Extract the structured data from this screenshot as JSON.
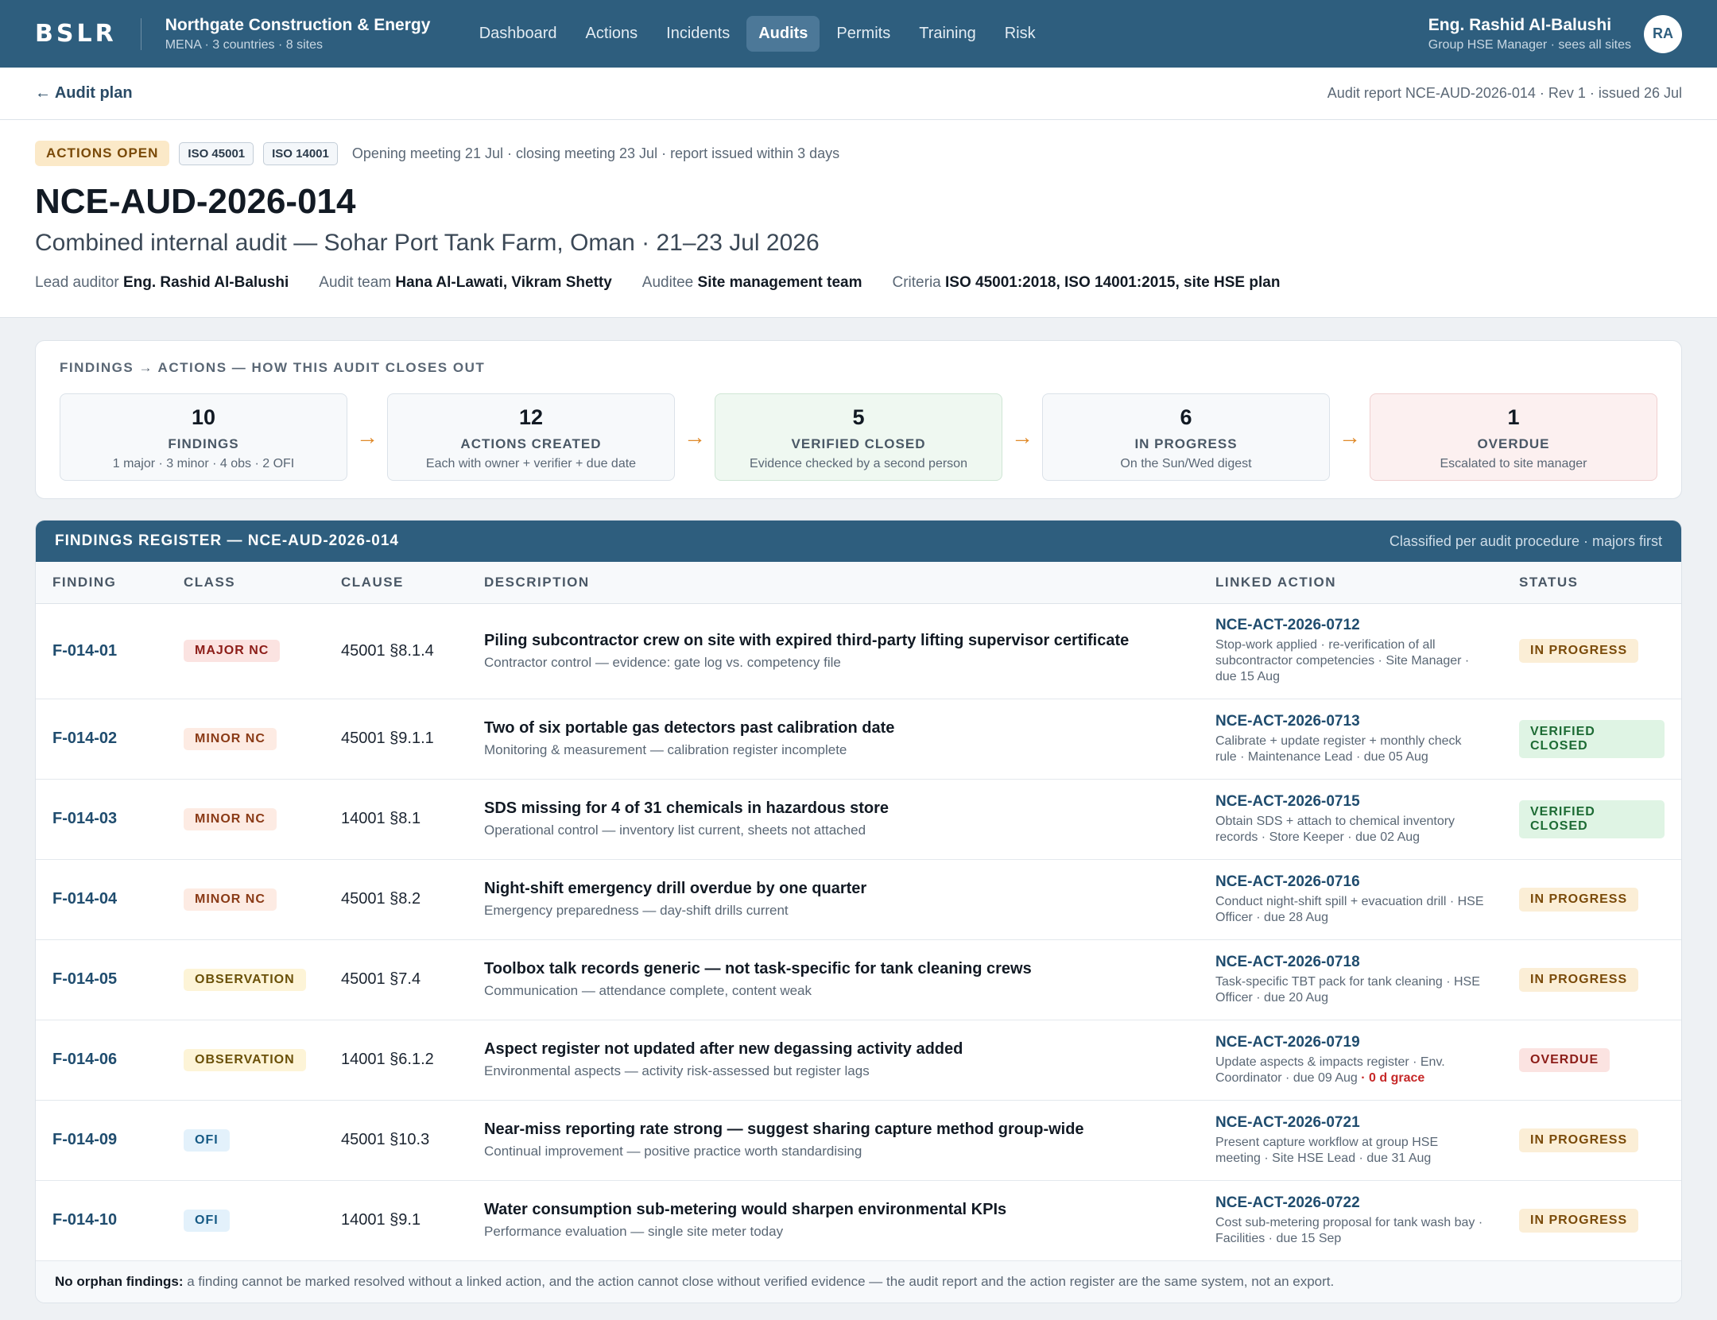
{
  "topbar": {
    "logo": "BSLR",
    "org_name": "Northgate Construction & Energy",
    "org_sub": "MENA · 3 countries · 8 sites",
    "nav": [
      {
        "label": "Dashboard",
        "active": false
      },
      {
        "label": "Actions",
        "active": false
      },
      {
        "label": "Incidents",
        "active": false
      },
      {
        "label": "Audits",
        "active": true
      },
      {
        "label": "Permits",
        "active": false
      },
      {
        "label": "Training",
        "active": false
      },
      {
        "label": "Risk",
        "active": false
      }
    ],
    "user_name": "Eng. Rashid Al-Balushi",
    "user_role": "Group HSE Manager · sees all sites",
    "avatar_initials": "RA"
  },
  "subbar": {
    "back_label": "← Audit plan",
    "report_meta": "Audit report NCE-AUD-2026-014 · Rev 1 · issued 26 Jul"
  },
  "head": {
    "status_tag": "ACTIONS OPEN",
    "iso_tags": [
      "ISO 45001",
      "ISO 14001"
    ],
    "meeting": "Opening meeting 21 Jul · closing meeting 23 Jul · report issued within 3 days",
    "audit_id": "NCE-AUD-2026-014",
    "audit_title": "Combined internal audit — Sohar Port Tank Farm, Oman · 21–23 Jul 2026",
    "people": [
      {
        "label": "Lead auditor",
        "value": "Eng. Rashid Al-Balushi"
      },
      {
        "label": "Audit team",
        "value": "Hana Al-Lawati, Vikram Shetty"
      },
      {
        "label": "Auditee",
        "value": "Site management team"
      },
      {
        "label": "Criteria",
        "value": "ISO 45001:2018, ISO 14001:2015, site HSE plan"
      }
    ]
  },
  "pipeline": {
    "title": "FINDINGS → ACTIONS — HOW THIS AUDIT CLOSES OUT",
    "arrow": "→",
    "steps": [
      {
        "num": "10",
        "label": "FINDINGS",
        "sub": "1 major · 3 minor · 4 obs · 2 OFI",
        "tone": "neutral"
      },
      {
        "num": "12",
        "label": "ACTIONS CREATED",
        "sub": "Each with owner + verifier + due date",
        "tone": "neutral"
      },
      {
        "num": "5",
        "label": "VERIFIED CLOSED",
        "sub": "Evidence checked by a second person",
        "tone": "green"
      },
      {
        "num": "6",
        "label": "IN PROGRESS",
        "sub": "On the Sun/Wed digest",
        "tone": "neutral"
      },
      {
        "num": "1",
        "label": "OVERDUE",
        "sub": "Escalated to site manager",
        "tone": "red"
      }
    ]
  },
  "register": {
    "title": "FINDINGS REGISTER — NCE-AUD-2026-014",
    "note": "Classified per audit procedure · majors first",
    "columns": [
      "FINDING",
      "CLASS",
      "CLAUSE",
      "DESCRIPTION",
      "LINKED ACTION",
      "STATUS"
    ],
    "rows": [
      {
        "id": "F-014-01",
        "cls": "MAJOR NC",
        "cls_kind": "major",
        "clause": "45001 §8.1.4",
        "title": "Piling subcontractor crew on site with expired third-party lifting supervisor certificate",
        "sub": "Contractor control — evidence: gate log vs. competency file",
        "action": "NCE-ACT-2026-0712",
        "action_sub": "Stop-work applied · re-verification of all subcontractor competencies · Site Manager · due 15 Aug",
        "grace": "",
        "status": "IN PROGRESS",
        "status_kind": "inprog"
      },
      {
        "id": "F-014-02",
        "cls": "MINOR NC",
        "cls_kind": "minor",
        "clause": "45001 §9.1.1",
        "title": "Two of six portable gas detectors past calibration date",
        "sub": "Monitoring & measurement — calibration register incomplete",
        "action": "NCE-ACT-2026-0713",
        "action_sub": "Calibrate + update register + monthly check rule · Maintenance Lead · due 05 Aug",
        "grace": "",
        "status": "VERIFIED CLOSED",
        "status_kind": "verified"
      },
      {
        "id": "F-014-03",
        "cls": "MINOR NC",
        "cls_kind": "minor",
        "clause": "14001 §8.1",
        "title": "SDS missing for 4 of 31 chemicals in hazardous store",
        "sub": "Operational control — inventory list current, sheets not attached",
        "action": "NCE-ACT-2026-0715",
        "action_sub": "Obtain SDS + attach to chemical inventory records · Store Keeper · due 02 Aug",
        "grace": "",
        "status": "VERIFIED CLOSED",
        "status_kind": "verified"
      },
      {
        "id": "F-014-04",
        "cls": "MINOR NC",
        "cls_kind": "minor",
        "clause": "45001 §8.2",
        "title": "Night-shift emergency drill overdue by one quarter",
        "sub": "Emergency preparedness — day-shift drills current",
        "action": "NCE-ACT-2026-0716",
        "action_sub": "Conduct night-shift spill + evacuation drill · HSE Officer · due 28 Aug",
        "grace": "",
        "status": "IN PROGRESS",
        "status_kind": "inprog"
      },
      {
        "id": "F-014-05",
        "cls": "OBSERVATION",
        "cls_kind": "obs",
        "clause": "45001 §7.4",
        "title": "Toolbox talk records generic — not task-specific for tank cleaning crews",
        "sub": "Communication — attendance complete, content weak",
        "action": "NCE-ACT-2026-0718",
        "action_sub": "Task-specific TBT pack for tank cleaning · HSE Officer · due 20 Aug",
        "grace": "",
        "status": "IN PROGRESS",
        "status_kind": "inprog"
      },
      {
        "id": "F-014-06",
        "cls": "OBSERVATION",
        "cls_kind": "obs",
        "clause": "14001 §6.1.2",
        "title": "Aspect register not updated after new degassing activity added",
        "sub": "Environmental aspects — activity risk-assessed but register lags",
        "action": "NCE-ACT-2026-0719",
        "action_sub": "Update aspects & impacts register · Env. Coordinator · due 09 Aug",
        "grace": " · 0 d grace",
        "status": "OVERDUE",
        "status_kind": "overdue"
      },
      {
        "id": "F-014-09",
        "cls": "OFI",
        "cls_kind": "ofi",
        "clause": "45001 §10.3",
        "title": "Near-miss reporting rate strong — suggest sharing capture method group-wide",
        "sub": "Continual improvement — positive practice worth standardising",
        "action": "NCE-ACT-2026-0721",
        "action_sub": "Present capture workflow at group HSE meeting · Site HSE Lead · due 31 Aug",
        "grace": "",
        "status": "IN PROGRESS",
        "status_kind": "inprog"
      },
      {
        "id": "F-014-10",
        "cls": "OFI",
        "cls_kind": "ofi",
        "clause": "14001 §9.1",
        "title": "Water consumption sub-metering would sharpen environmental KPIs",
        "sub": "Performance evaluation — single site meter today",
        "action": "NCE-ACT-2026-0722",
        "action_sub": "Cost sub-metering proposal for tank wash bay · Facilities · due 15 Sep",
        "grace": "",
        "status": "IN PROGRESS",
        "status_kind": "inprog"
      }
    ],
    "footnote_bold": "No orphan findings:",
    "footnote_text": " a finding cannot be marked resolved without a linked action, and the action cannot close without verified evidence — the audit report and the action register are the same system, not an export."
  },
  "colors": {
    "brand": "#2e5e7e",
    "arrow": "#e08a2a",
    "overdue_grace": "#c62828"
  }
}
